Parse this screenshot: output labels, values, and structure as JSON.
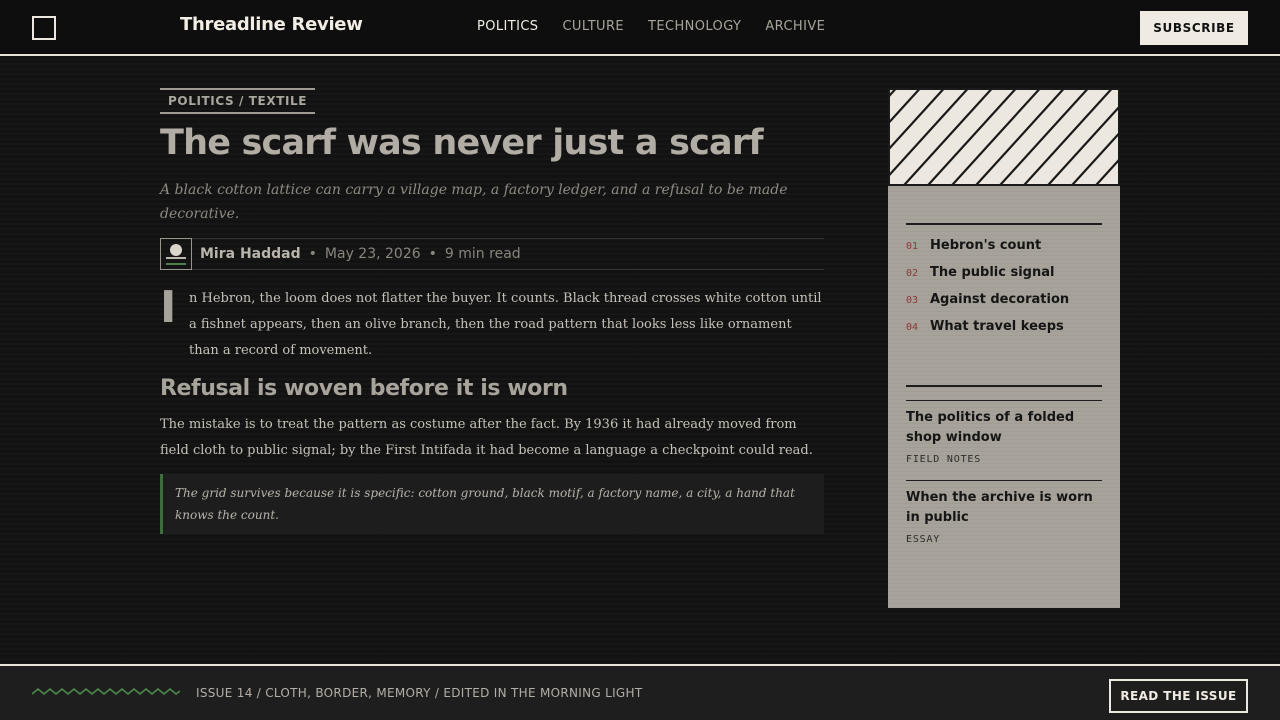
{
  "header": {
    "brand": "Threadline Review",
    "nav": [
      {
        "label": "POLITICS",
        "active": true
      },
      {
        "label": "CULTURE",
        "active": false
      },
      {
        "label": "TECHNOLOGY",
        "active": false
      },
      {
        "label": "ARCHIVE",
        "active": false
      }
    ],
    "subscribe_label": "SUBSCRIBE"
  },
  "article": {
    "kicker": "POLITICS / TEXTILE",
    "title": "The scarf was never just a scarf",
    "dek": "A black cotton lattice can carry a village map, a factory ledger, and a refusal to be made decorative.",
    "byline": {
      "author": "Mira Haddad",
      "separator": "•",
      "date": "May 23, 2026",
      "read_time": "9 min read"
    },
    "lead": {
      "dropcap": "I",
      "text": "n Hebron, the loom does not flatter the buyer. It counts. Black thread crosses white cotton until a fishnet appears, then an olive branch, then the road pattern that looks less like ornament than a record of movement."
    },
    "subhead": "Refusal is woven before it is worn",
    "paragraph": "The mistake is to treat the pattern as costume after the fact. By 1936 it had already moved from field cloth to public signal; by the First Intifada it had become a language a checkpoint could read.",
    "pullquote": "The grid survives because it is specific: cotton ground, black motif, a factory name, a city, a hand that knows the count."
  },
  "sidebar": {
    "toc": [
      {
        "num": "01",
        "label": "Hebron's count"
      },
      {
        "num": "02",
        "label": "The public signal"
      },
      {
        "num": "03",
        "label": "Against decoration"
      },
      {
        "num": "04",
        "label": "What travel keeps"
      }
    ],
    "related": [
      {
        "title": "The politics of a folded shop window",
        "tag": "FIELD NOTES"
      },
      {
        "title": "When the archive is worn in public",
        "tag": "ESSAY"
      }
    ]
  },
  "footer": {
    "text": "ISSUE 14 / CLOTH, BORDER, MEMORY / EDITED IN THE MORNING LIGHT",
    "cta_label": "READ THE ISSUE"
  },
  "colors": {
    "background": "#121212",
    "paper": "#ece8df",
    "sidebar": "#a7a39a",
    "accent_green": "#3e6d3c",
    "accent_red": "#8a3a3a"
  },
  "icons": [
    "square-logo-icon",
    "author-avatar-icon",
    "hatch-pattern",
    "zigzag-icon"
  ]
}
